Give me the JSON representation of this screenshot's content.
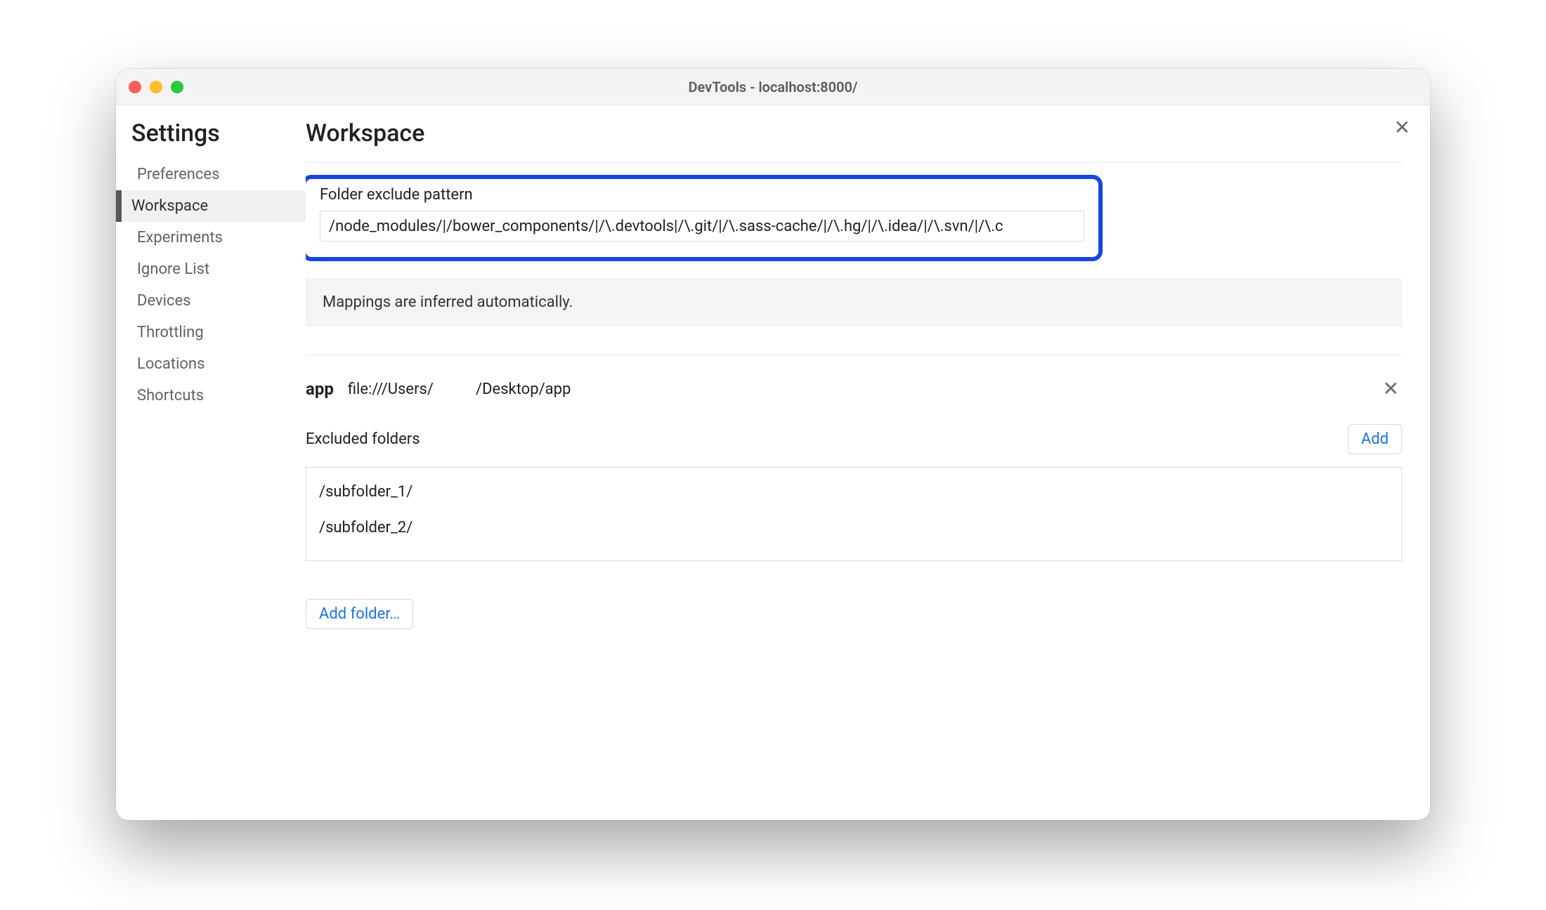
{
  "window": {
    "title": "DevTools - localhost:8000/"
  },
  "sidebar": {
    "heading": "Settings",
    "items": [
      "Preferences",
      "Workspace",
      "Experiments",
      "Ignore List",
      "Devices",
      "Throttling",
      "Locations",
      "Shortcuts"
    ],
    "selected_index": 1
  },
  "page": {
    "heading": "Workspace",
    "exclude_pattern": {
      "label": "Folder exclude pattern",
      "value": "/node_modules/|/bower_components/|/\\.devtools|/\\.git/|/\\.sass-cache/|/\\.hg/|/\\.idea/|/\\.svn/|/\\.c"
    },
    "info_banner": "Mappings are inferred automatically.",
    "folder": {
      "name": "app",
      "path_prefix": "file:///Users/",
      "path_suffix": "/Desktop/app"
    },
    "excluded": {
      "label": "Excluded folders",
      "add_label": "Add",
      "items": [
        "/subfolder_1/",
        "/subfolder_2/"
      ]
    },
    "add_folder_label": "Add folder…"
  }
}
